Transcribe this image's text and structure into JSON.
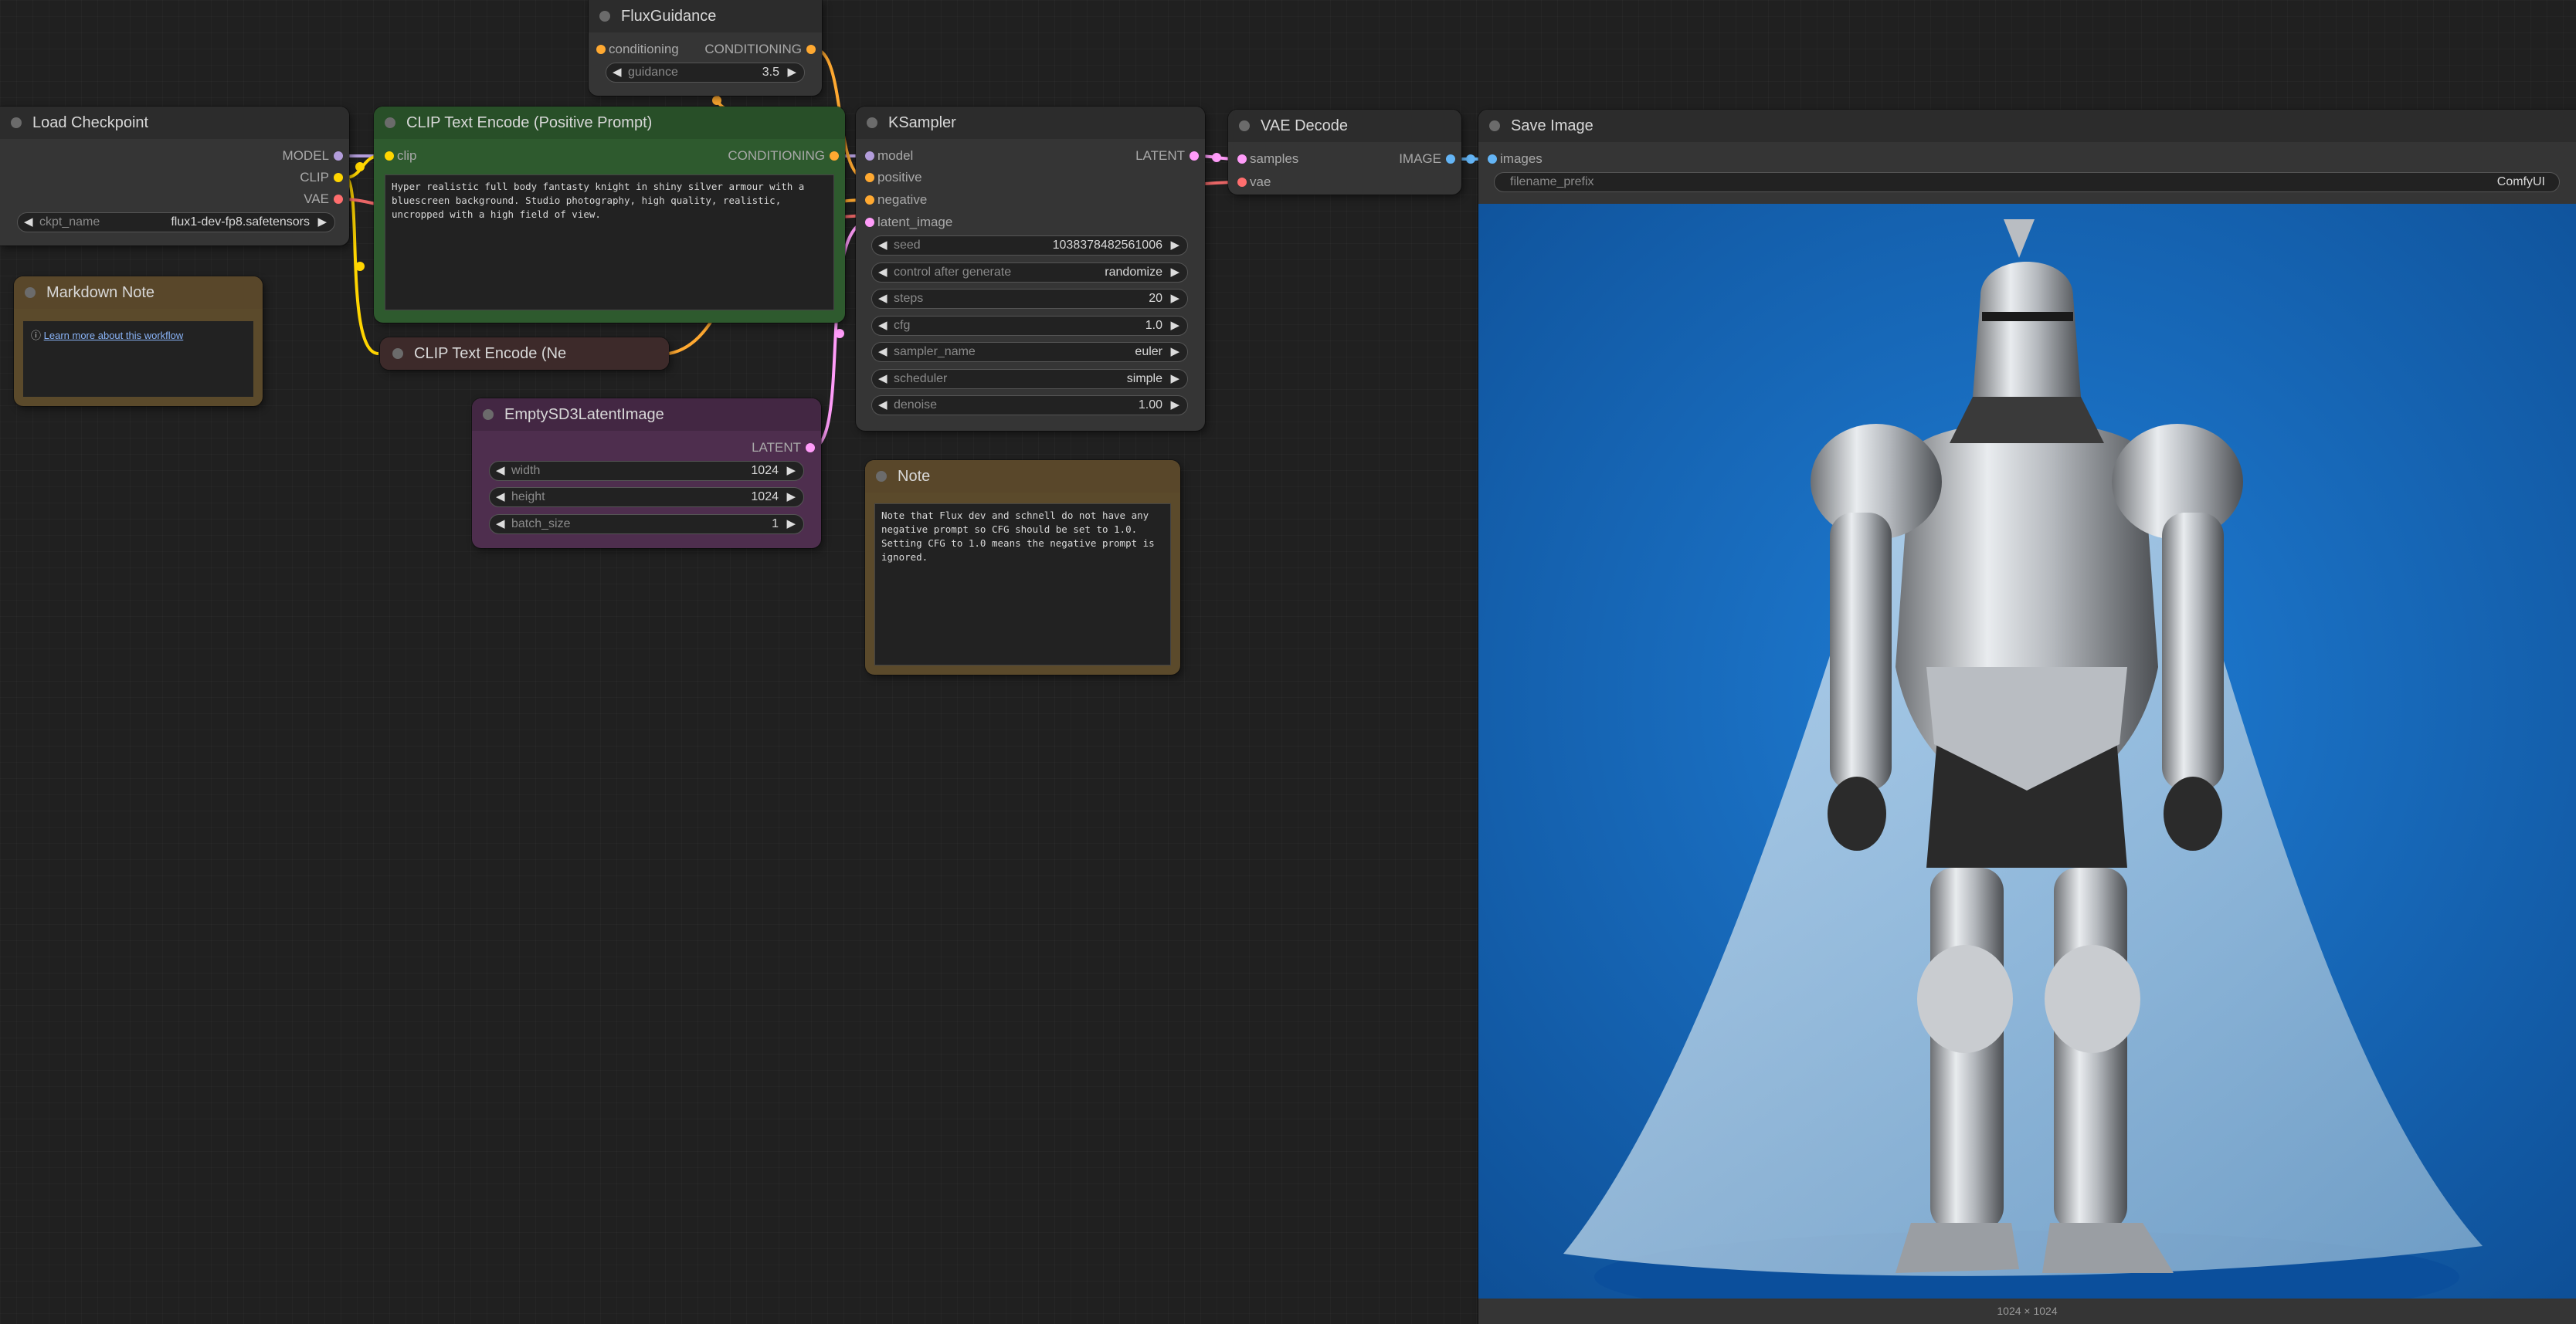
{
  "colors": {
    "model": "#b39ddb",
    "clip": "#ffd500",
    "vae": "#ff6e6e",
    "conditioning": "#ffa931",
    "latent": "#ff9cf9",
    "image": "#64b5f6",
    "green_node": "#2e5a2e",
    "purple_node": "#4e2e4e",
    "brown_node": "#5b4a2b",
    "red_node": "#3d2a2a"
  },
  "flux_guidance": {
    "title": "FluxGuidance",
    "input": "conditioning",
    "output": "CONDITIONING",
    "widget": {
      "label": "guidance",
      "value": "3.5"
    }
  },
  "load_checkpoint": {
    "title": "Load Checkpoint",
    "outputs": [
      "MODEL",
      "CLIP",
      "VAE"
    ],
    "widget": {
      "label": "ckpt_name",
      "value": "flux1-dev-fp8.safetensors"
    }
  },
  "clip_positive": {
    "title": "CLIP Text Encode (Positive Prompt)",
    "input": "clip",
    "output": "CONDITIONING",
    "text": "Hyper realistic full body fantasty knight in shiny silver armour with a bluescreen background. Studio photography, high quality, realistic, uncropped with a high field of view."
  },
  "clip_negative": {
    "title": "CLIP Text Encode (Ne"
  },
  "markdown_note": {
    "title": "Markdown Note",
    "icon": "ⓘ",
    "link": "Learn more about this workflow"
  },
  "empty_latent": {
    "title": "EmptySD3LatentImage",
    "output": "LATENT",
    "widgets": [
      {
        "label": "width",
        "value": "1024"
      },
      {
        "label": "height",
        "value": "1024"
      },
      {
        "label": "batch_size",
        "value": "1"
      }
    ]
  },
  "ksampler": {
    "title": "KSampler",
    "inputs": [
      "model",
      "positive",
      "negative",
      "latent_image"
    ],
    "output": "LATENT",
    "widgets": [
      {
        "label": "seed",
        "value": "1038378482561006"
      },
      {
        "label": "control after generate",
        "value": "randomize"
      },
      {
        "label": "steps",
        "value": "20"
      },
      {
        "label": "cfg",
        "value": "1.0"
      },
      {
        "label": "sampler_name",
        "value": "euler"
      },
      {
        "label": "scheduler",
        "value": "simple"
      },
      {
        "label": "denoise",
        "value": "1.00"
      }
    ]
  },
  "note": {
    "title": "Note",
    "text": "Note that Flux dev and schnell do not have any negative prompt so CFG should be set to 1.0. Setting CFG to 1.0 means the negative prompt is ignored."
  },
  "vae_decode": {
    "title": "VAE Decode",
    "inputs": [
      "samples",
      "vae"
    ],
    "output": "IMAGE"
  },
  "save_image": {
    "title": "Save Image",
    "input": "images",
    "widget": {
      "label": "filename_prefix",
      "value": "ComfyUI"
    },
    "image_size": "1024 × 1024",
    "image_subject": "knight in silver armour on blue background"
  }
}
